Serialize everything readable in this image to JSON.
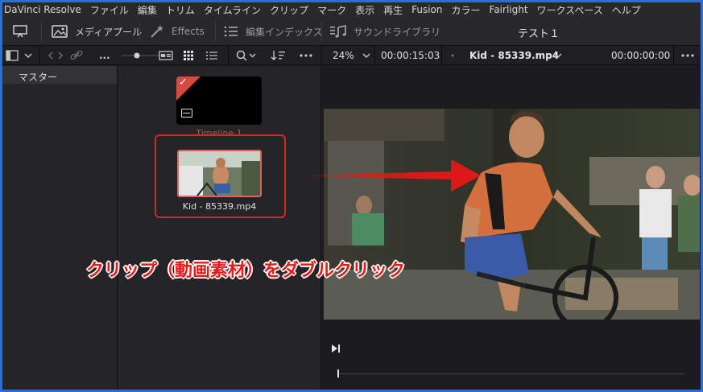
{
  "menubar": {
    "items": [
      "DaVinci Resolve",
      "ファイル",
      "編集",
      "トリム",
      "タイムライン",
      "クリップ",
      "マーク",
      "表示",
      "再生",
      "Fusion",
      "カラー",
      "Fairlight",
      "ワークスペース",
      "ヘルプ"
    ]
  },
  "toolbar": {
    "media_pool": "メディアプール",
    "effects": "Effects",
    "edit_index": "編集インデックス",
    "sound_library": "サウンドライブラリ",
    "project_title": "テスト１"
  },
  "subbar": {
    "ellipsis": "...",
    "zoom": "24%",
    "duration": "00:00:15:03",
    "clip_name": "Kid - 85339.mp4",
    "timecode": "00:00:00:00"
  },
  "bins": {
    "master": "マスター"
  },
  "clips": [
    {
      "name": "Timeline 1"
    },
    {
      "name": "Kid - 85339.mp4"
    }
  ],
  "annotation": {
    "caption": "クリップ（動画素材）をダブルクリック",
    "color": "#e51a1a"
  }
}
